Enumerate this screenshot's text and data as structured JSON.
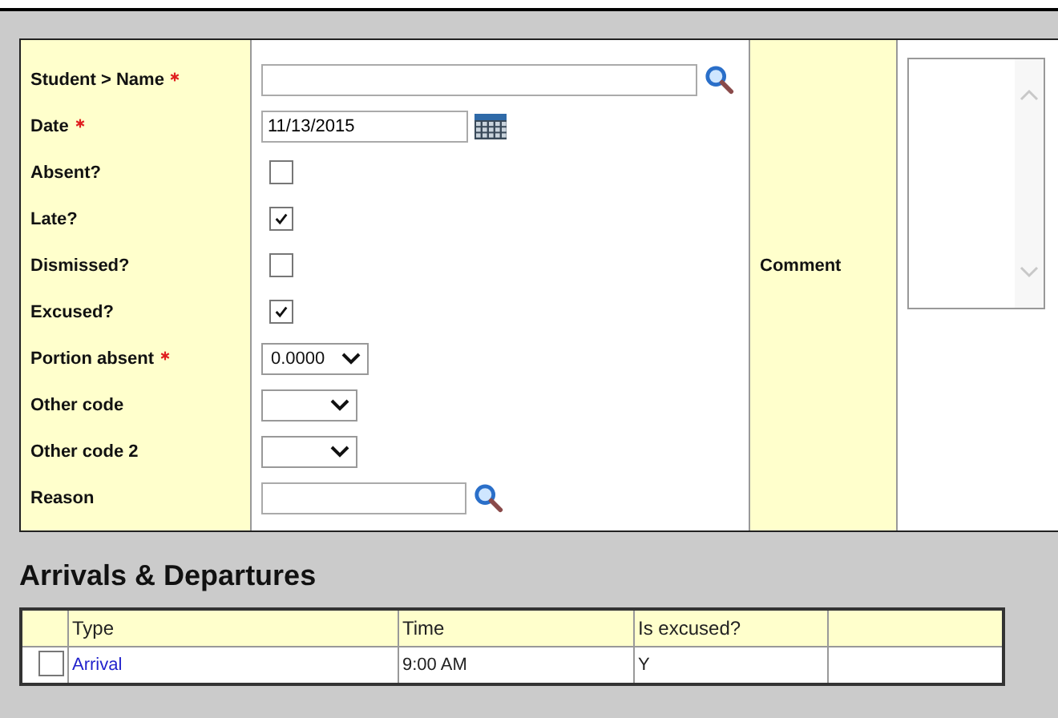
{
  "form": {
    "fields": [
      {
        "label": "Student > Name",
        "required": true,
        "kind": "lookup"
      },
      {
        "label": "Date",
        "required": true,
        "kind": "date",
        "value": "11/13/2015"
      },
      {
        "label": "Absent?",
        "required": false,
        "kind": "checkbox",
        "checked": false
      },
      {
        "label": "Late?",
        "required": false,
        "kind": "checkbox",
        "checked": true
      },
      {
        "label": "Dismissed?",
        "required": false,
        "kind": "checkbox",
        "checked": false
      },
      {
        "label": "Excused?",
        "required": false,
        "kind": "checkbox",
        "checked": true
      },
      {
        "label": "Portion absent",
        "required": true,
        "kind": "select",
        "value": "0.0000"
      },
      {
        "label": "Other code",
        "required": false,
        "kind": "select"
      },
      {
        "label": "Other code 2",
        "required": false,
        "kind": "select"
      },
      {
        "label": "Reason",
        "required": false,
        "kind": "short-lookup"
      }
    ],
    "comment": {
      "label": "Comment"
    }
  },
  "arrivals": {
    "title": "Arrivals & Departures",
    "columns": [
      "Type",
      "Time",
      "Is excused?"
    ],
    "rows": [
      {
        "checked": false,
        "type": "Arrival",
        "time": "9:00 AM",
        "excused": "Y"
      }
    ]
  }
}
